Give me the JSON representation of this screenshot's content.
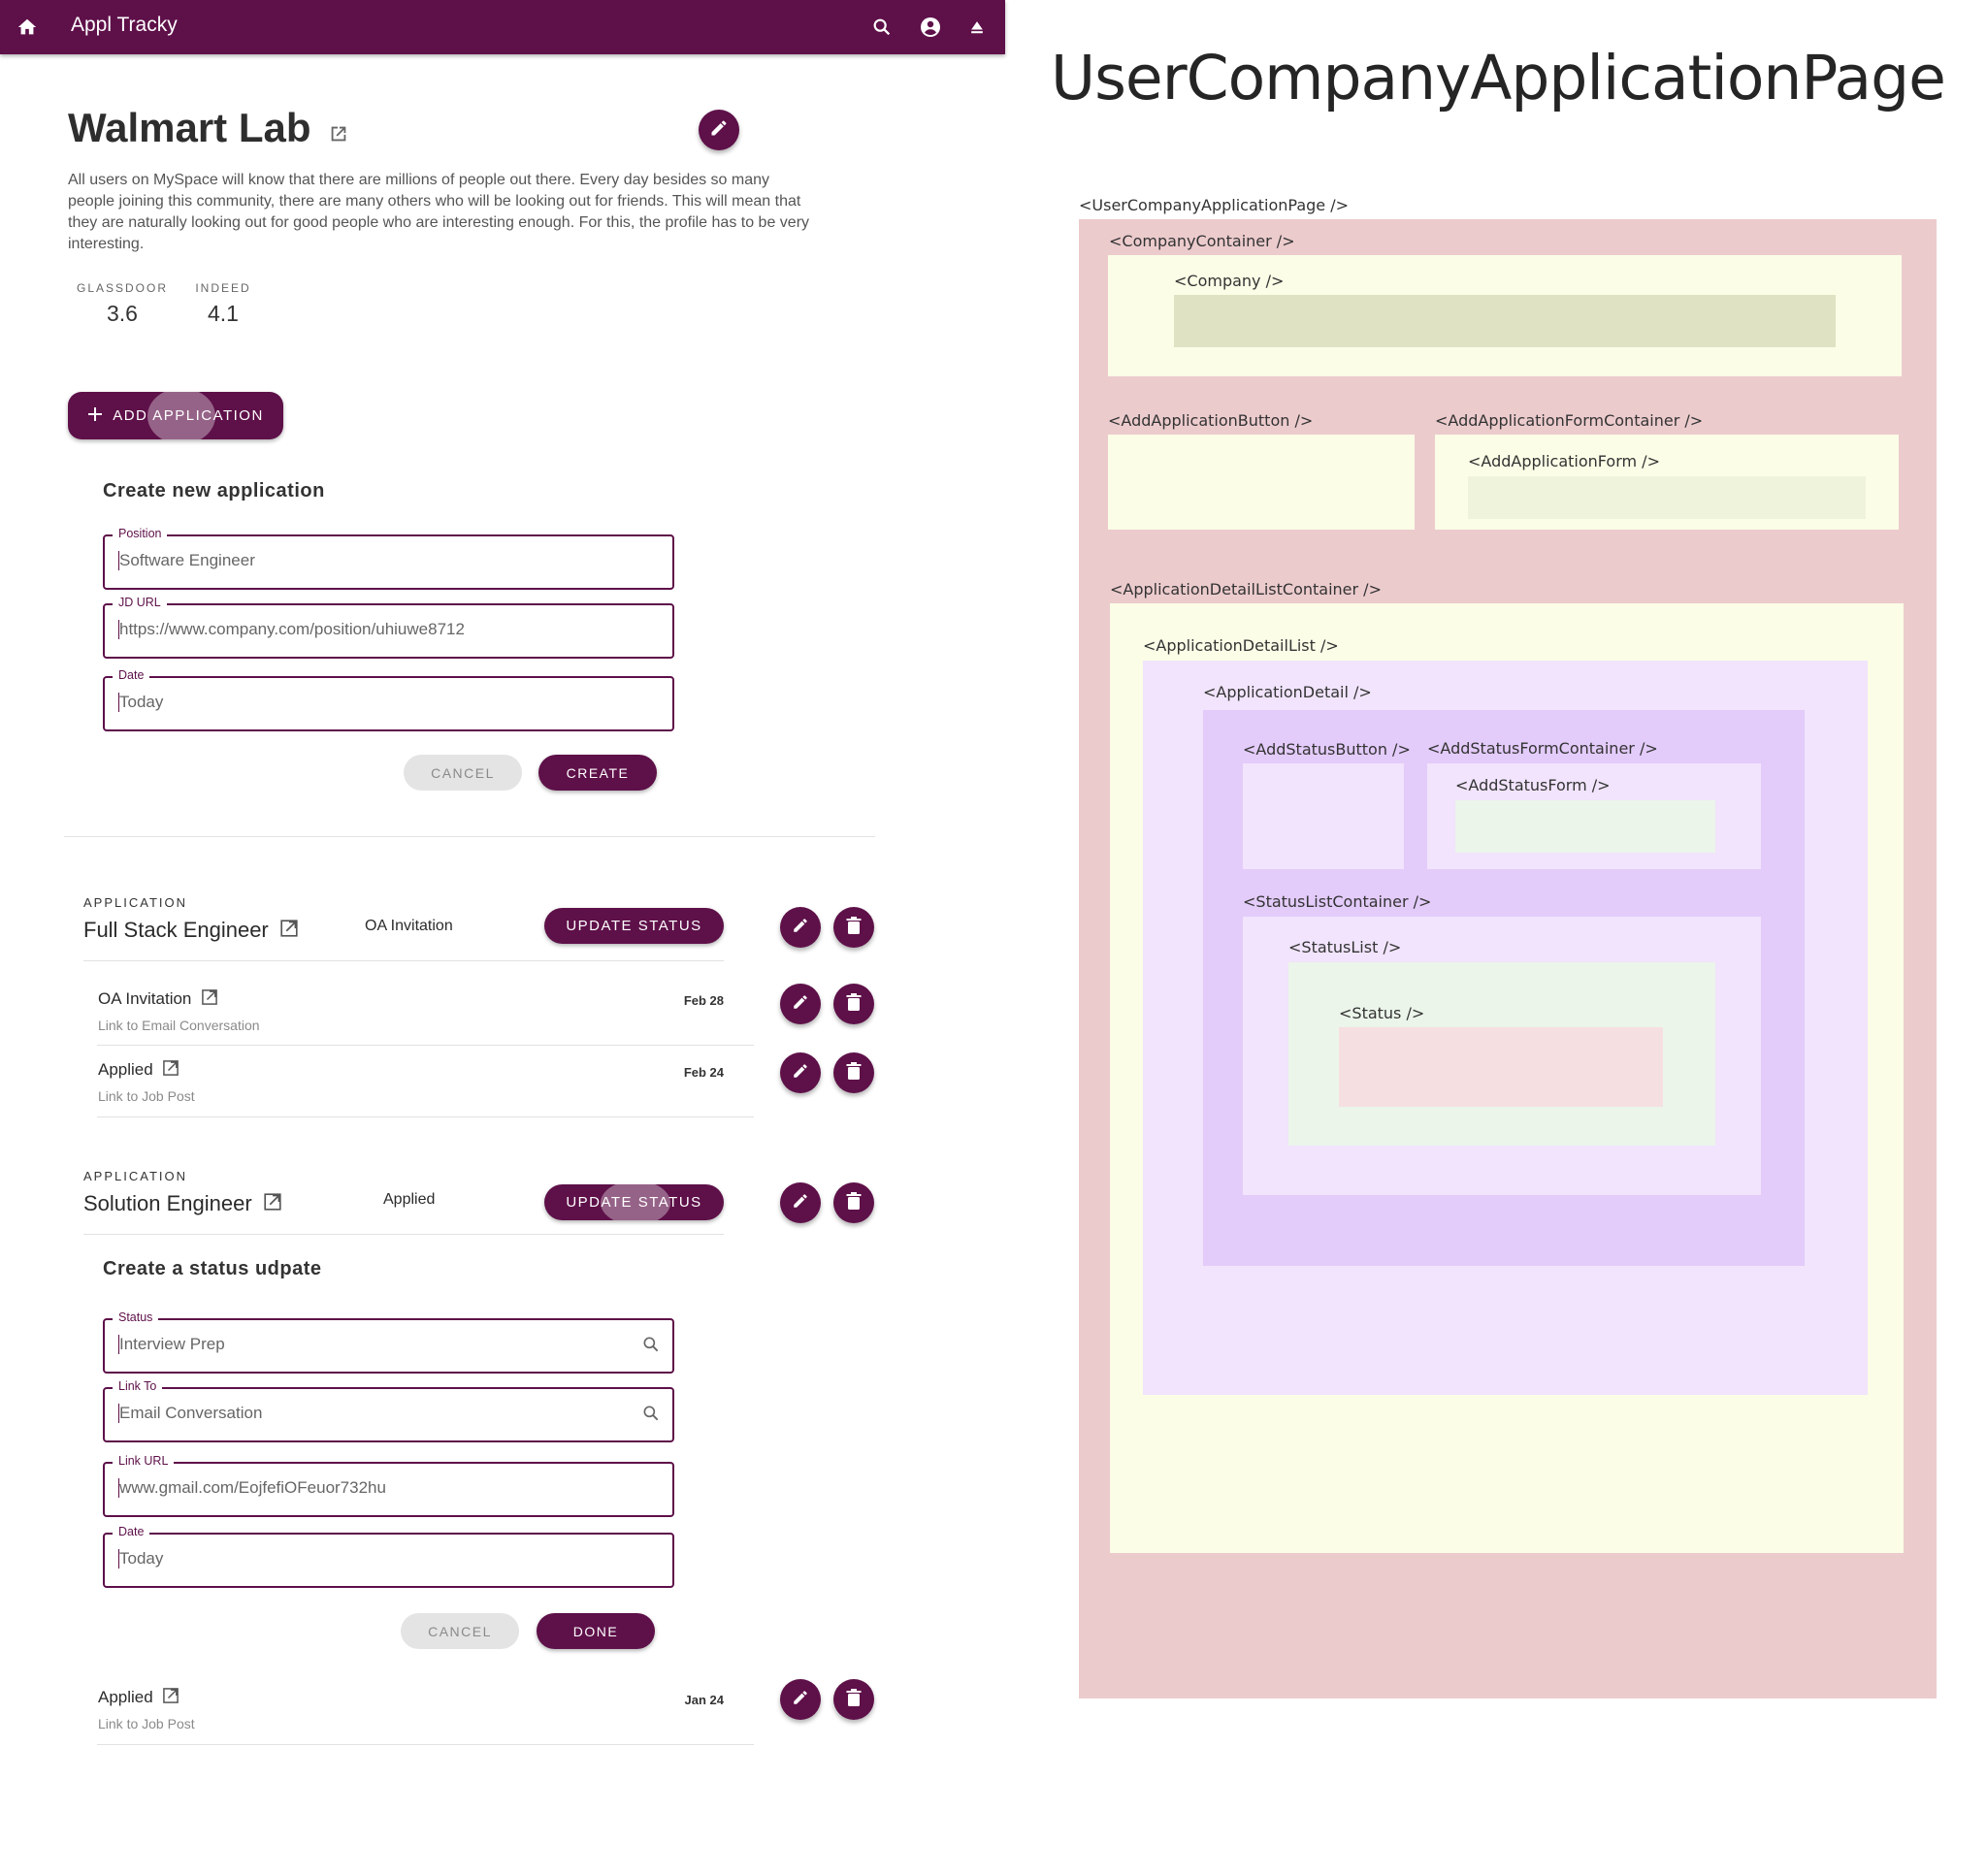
{
  "navbar": {
    "title": "Appl Tracky",
    "icons": [
      "home-icon",
      "search-icon",
      "account-circle-icon",
      "eject-icon"
    ],
    "color": "#5e1049"
  },
  "company": {
    "name": "Walmart Lab",
    "description": "All users on MySpace will know that there are millions of people out there. Every day besides so many people joining this community, there are many others who will be looking out for friends. This will mean that they are naturally looking out for good people who are interesting enough. For this, the profile has to be very interesting.",
    "ratings": [
      {
        "label": "GLASSDOOR",
        "value": "3.6"
      },
      {
        "label": "INDEED",
        "value": "4.1"
      }
    ]
  },
  "add_application": {
    "button_label": "ADD APPLICATION",
    "form": {
      "title": "Create new application",
      "fields": [
        {
          "label": "Position",
          "value": "Software Engineer"
        },
        {
          "label": "JD URL",
          "value": "https://www.company.com/position/uhiuwe8712"
        },
        {
          "label": "Date",
          "value": "Today"
        }
      ],
      "cancel_label": "CANCEL",
      "submit_label": "CREATE"
    }
  },
  "applications": [
    {
      "kicker": "APPLICATION",
      "title": "Full Stack Engineer",
      "current_status": "OA Invitation",
      "update_label": "UPDATE STATUS",
      "statuses": [
        {
          "name": "OA Invitation",
          "link": "Link to Email Conversation",
          "date": "Feb 28"
        },
        {
          "name": "Applied",
          "link": "Link to Job Post",
          "date": "Feb 24"
        }
      ]
    },
    {
      "kicker": "APPLICATION",
      "title": "Solution Engineer",
      "current_status": "Applied",
      "update_label": "UPDATE STATUS",
      "status_form": {
        "title": "Create a status udpate",
        "fields": [
          {
            "label": "Status",
            "value": "Interview Prep",
            "icon": "search-icon"
          },
          {
            "label": "Link To",
            "value": "Email Conversation",
            "icon": "search-icon"
          },
          {
            "label": "Link URL",
            "value": "www.gmail.com/EojfefiOFeuor732hu"
          },
          {
            "label": "Date",
            "value": "Today"
          }
        ],
        "cancel_label": "CANCEL",
        "submit_label": "DONE"
      },
      "statuses": [
        {
          "name": "Applied",
          "link": "Link to Job Post",
          "date": "Jan 24"
        }
      ]
    }
  ],
  "diagram": {
    "title": "UserCompanyApplicationPage",
    "components": {
      "page": {
        "label": "<UserCompanyApplicationPage  />",
        "color": "#eccbcd"
      },
      "company_container": {
        "label": "<CompanyContainer  />",
        "color": "#fbfde6"
      },
      "company": {
        "label": "<Company  />",
        "color": "#e0e2c4"
      },
      "add_application_button": {
        "label": "<AddApplicationButton  />",
        "color": "#fbfde6"
      },
      "add_application_form_container": {
        "label": "<AddApplicationFormContainer  />",
        "color": "#fbfde6"
      },
      "add_application_form": {
        "label": "<AddApplicationForm  />",
        "color": "#f0f3dc"
      },
      "application_detail_list_container": {
        "label": "<ApplicationDetailListContainer  />",
        "color": "#fbfde6"
      },
      "application_detail_list": {
        "label": "<ApplicationDetailList  />",
        "color": "#f1e4fc"
      },
      "application_detail": {
        "label": "<ApplicationDetail  />",
        "color": "#e3cbfa"
      },
      "add_status_button": {
        "label": "<AddStatusButton />",
        "color": "#f1e4fc"
      },
      "add_status_form_container": {
        "label": "<AddStatusFormContainer  />",
        "color": "#f1e4fc"
      },
      "add_status_form": {
        "label": "<AddStatusForm  />",
        "color": "#ebf5ea"
      },
      "status_list_container": {
        "label": "<StatusListContainer  />",
        "color": "#f1e4fc"
      },
      "status_list": {
        "label": "<StatusList  />",
        "color": "#ebf5ea"
      },
      "status": {
        "label": "<Status  />",
        "color": "#f6dfe1"
      }
    }
  }
}
